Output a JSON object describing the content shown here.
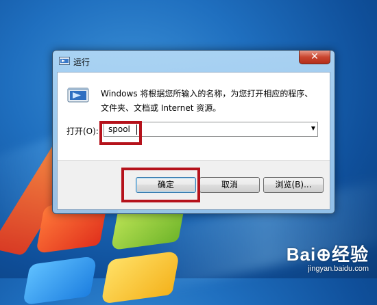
{
  "dialog": {
    "title": "运行",
    "close_glyph": "✕",
    "description": "Windows 将根据您所输入的名称，为您打开相应的程序、文件夹、文档或 Internet 资源。",
    "open_label": "打开(O):",
    "input_value": "spool",
    "buttons": {
      "ok": "确定",
      "cancel": "取消",
      "browse": "浏览(B)..."
    }
  },
  "watermark": {
    "logo": "Bai⊕经验",
    "url": "jingyan.baidu.com"
  },
  "colors": {
    "highlight": "#b5121b",
    "close_button": "#c9452f",
    "desktop_blue": "#1f6fbf"
  },
  "icons": {
    "title": "run-icon",
    "program": "run-program-icon",
    "close": "close-icon",
    "dropdown": "chevron-down-icon"
  }
}
